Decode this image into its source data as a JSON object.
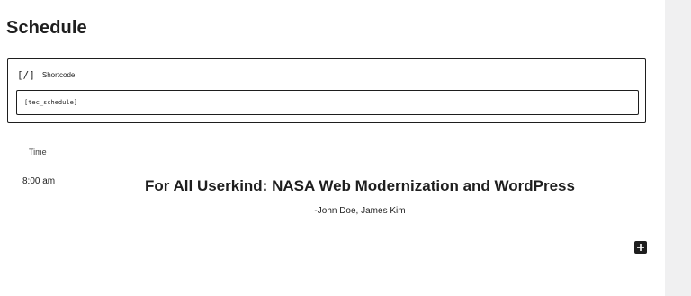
{
  "page": {
    "title": "Schedule"
  },
  "shortcode_block": {
    "icon": "[/]",
    "label": "Shortcode",
    "value": "[tec_schedule]"
  },
  "schedule": {
    "time_header": "Time",
    "sessions": [
      {
        "time": "8:00 am",
        "title": "For All Userkind: NASA Web Modernization and WordPress",
        "speakers": "-John Doe, James Kim"
      }
    ]
  },
  "editor": {
    "add_block_icon": "plus-icon"
  }
}
